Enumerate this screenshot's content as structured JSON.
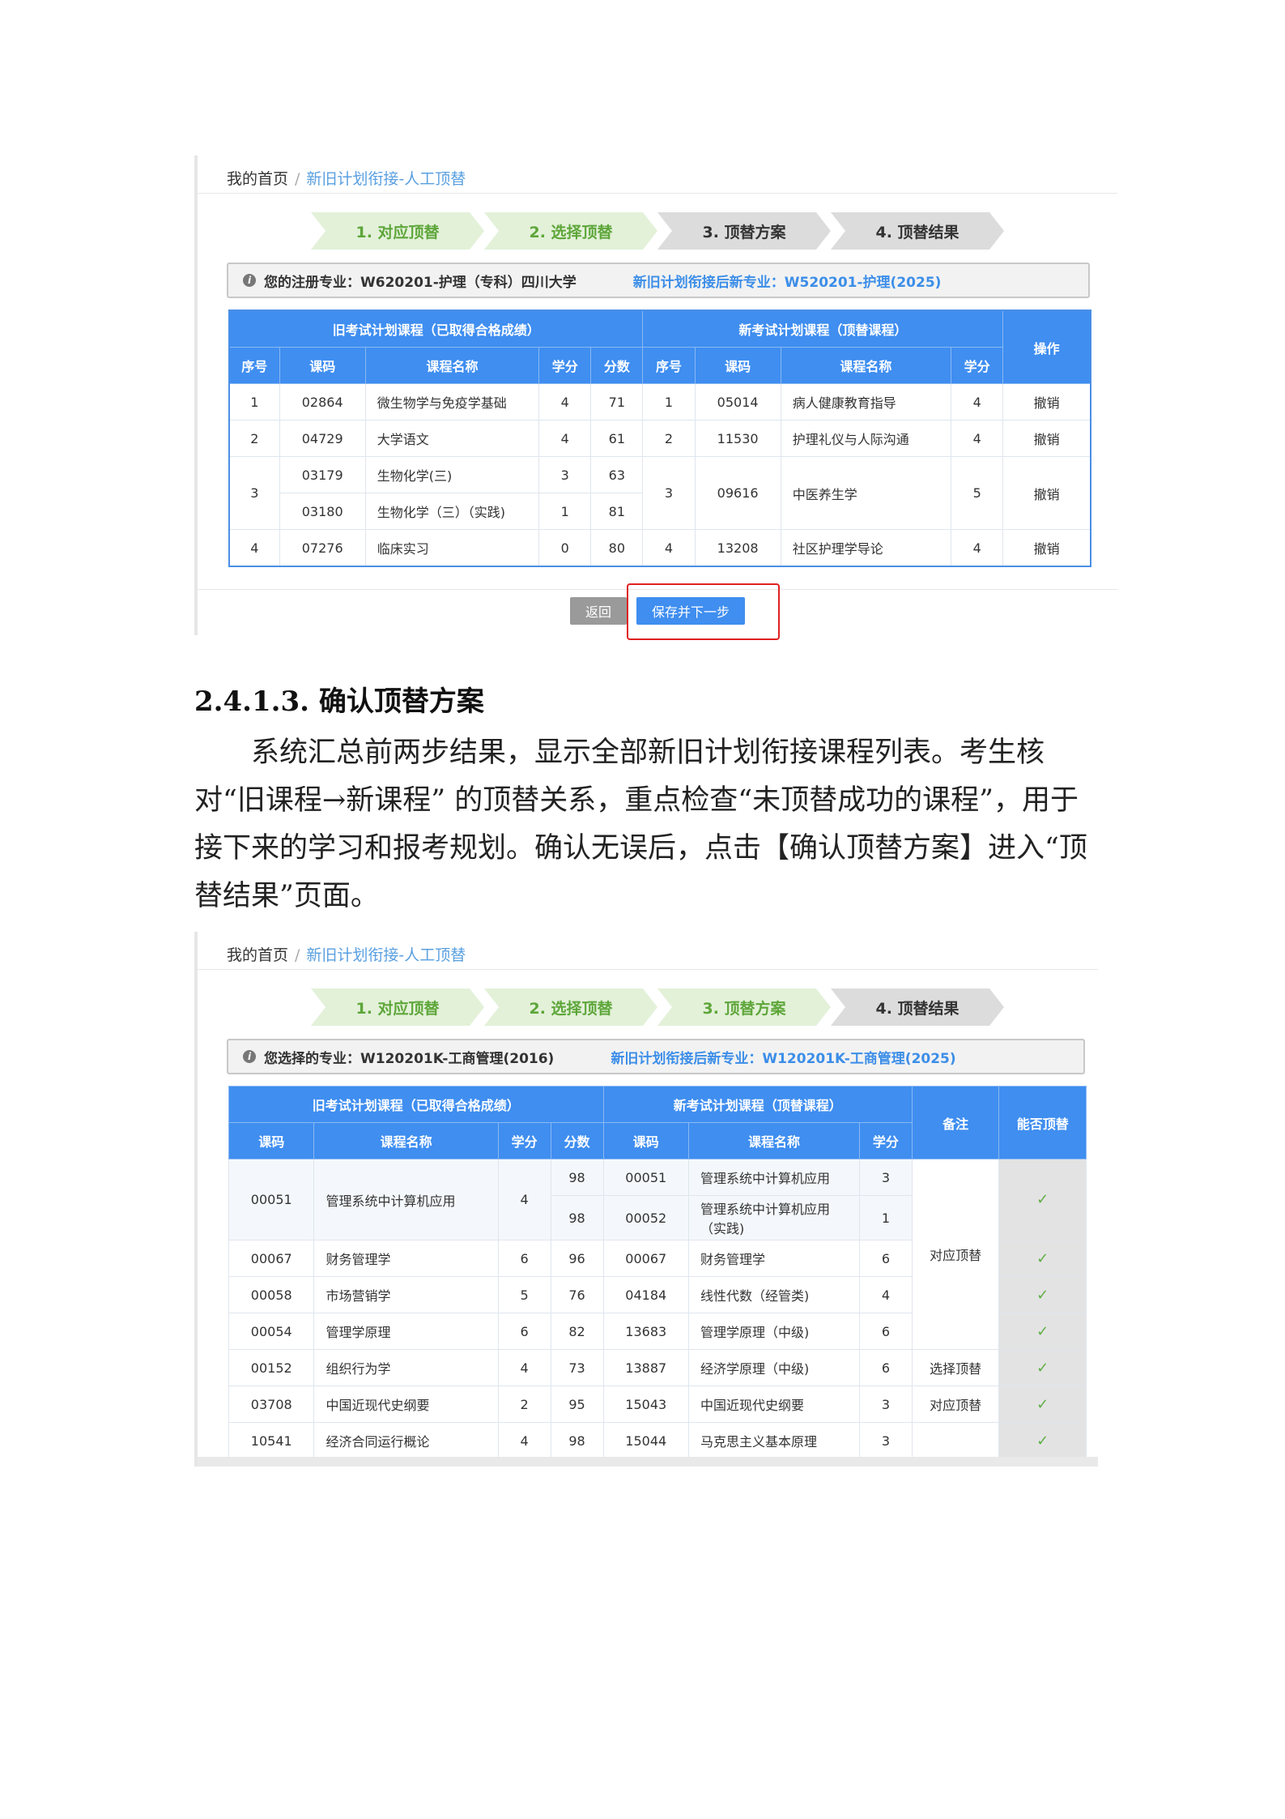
{
  "shot1": {
    "breadcrumb": {
      "home": "我的首页",
      "sep": "/",
      "current": "新旧计划衔接-人工顶替"
    },
    "steps": [
      "1. 对应顶替",
      "2. 选择顶替",
      "3. 顶替方案",
      "4. 顶替结果"
    ],
    "info": {
      "label": "您的注册专业：W620201-护理（专科）四川大学",
      "new_label": "新旧计划衔接后新专业：W520201-护理(2025)"
    },
    "group_old": "旧考试计划课程（已取得合格成绩）",
    "group_new": "新考试计划课程（顶替课程）",
    "op_header": "操作",
    "cols_old": [
      "序号",
      "课码",
      "课程名称",
      "学分",
      "分数"
    ],
    "cols_new": [
      "序号",
      "课码",
      "课程名称",
      "学分"
    ],
    "rows": [
      {
        "no": "1",
        "old": [
          [
            "02864",
            "微生物学与免疫学基础",
            "4",
            "71"
          ]
        ],
        "new_no": "1",
        "new": [
          "05014",
          "病人健康教育指导",
          "4"
        ],
        "op": "撤销"
      },
      {
        "no": "2",
        "old": [
          [
            "04729",
            "大学语文",
            "4",
            "61"
          ]
        ],
        "new_no": "2",
        "new": [
          "11530",
          "护理礼仪与人际沟通",
          "4"
        ],
        "op": "撤销"
      },
      {
        "no": "3",
        "old": [
          [
            "03179",
            "生物化学(三)",
            "3",
            "63"
          ],
          [
            "03180",
            "生物化学（三）（实践)",
            "1",
            "81"
          ]
        ],
        "new_no": "3",
        "new": [
          "09616",
          "中医养生学",
          "5"
        ],
        "op": "撤销"
      },
      {
        "no": "4",
        "old": [
          [
            "07276",
            "临床实习",
            "0",
            "80"
          ]
        ],
        "new_no": "4",
        "new": [
          "13208",
          "社区护理学导论",
          "4"
        ],
        "op": "撤销"
      }
    ],
    "btn_back": "返回",
    "btn_save": "保存并下一步"
  },
  "doc": {
    "heading": "2.4.1.3.  确认顶替方案",
    "paragraph": "系统汇总前两步结果，显示全部新旧计划衔接课程列表。考生核对“旧课程→新课程” 的顶替关系，重点检查“未顶替成功的课程”，用于接下来的学习和报考规划。确认无误后，点击【确认顶替方案】进入“顶替结果”页面。"
  },
  "shot2": {
    "breadcrumb": {
      "home": "我的首页",
      "sep": "/",
      "current": "新旧计划衔接-人工顶替"
    },
    "steps": [
      "1. 对应顶替",
      "2. 选择顶替",
      "3. 顶替方案",
      "4. 顶替结果"
    ],
    "info": {
      "label": "您选择的专业：W120201K-工商管理(2016)",
      "new_label": "新旧计划衔接后新专业：W120201K-工商管理(2025)"
    },
    "group_old": "旧考试计划课程（已取得合格成绩）",
    "group_new": "新考试计划课程（顶替课程）",
    "remark_header": "备注",
    "can_header": "能否顶替",
    "cols_old": [
      "课码",
      "课程名称",
      "学分",
      "分数"
    ],
    "cols_new": [
      "课码",
      "课程名称",
      "学分"
    ],
    "check": "✓",
    "rows": [
      {
        "old_code": "00051",
        "old_name": "管理系统中计算机应用",
        "old_credit": "4",
        "score": "98",
        "new": [
          "00051",
          "管理系统中计算机应用",
          "3"
        ]
      },
      {
        "score": "98",
        "new": [
          "00052",
          "管理系统中计算机应用（实践)",
          "1"
        ]
      },
      {
        "old_code": "00067",
        "old_name": "财务管理学",
        "old_credit": "6",
        "score": "96",
        "new": [
          "00067",
          "财务管理学",
          "6"
        ]
      },
      {
        "old_code": "00058",
        "old_name": "市场营销学",
        "old_credit": "5",
        "score": "76",
        "new": [
          "04184",
          "线性代数（经管类)",
          "4"
        ]
      },
      {
        "old_code": "00054",
        "old_name": "管理学原理",
        "old_credit": "6",
        "score": "82",
        "new": [
          "13683",
          "管理学原理（中级)",
          "6"
        ]
      },
      {
        "old_code": "00152",
        "old_name": "组织行为学",
        "old_credit": "4",
        "score": "73",
        "new": [
          "13887",
          "经济学原理（中级)",
          "6"
        ],
        "remark": "选择顶替"
      },
      {
        "old_code": "03708",
        "old_name": "中国近现代史纲要",
        "old_credit": "2",
        "score": "95",
        "new": [
          "15043",
          "中国近现代史纲要",
          "3"
        ],
        "remark": "对应顶替"
      },
      {
        "old_code": "10541",
        "old_name": "经济合同运行概论",
        "old_credit": "4",
        "score": "98",
        "new": [
          "15044",
          "马克思主义基本原理",
          "3"
        ]
      }
    ],
    "merged_remark": "对应顶替"
  }
}
